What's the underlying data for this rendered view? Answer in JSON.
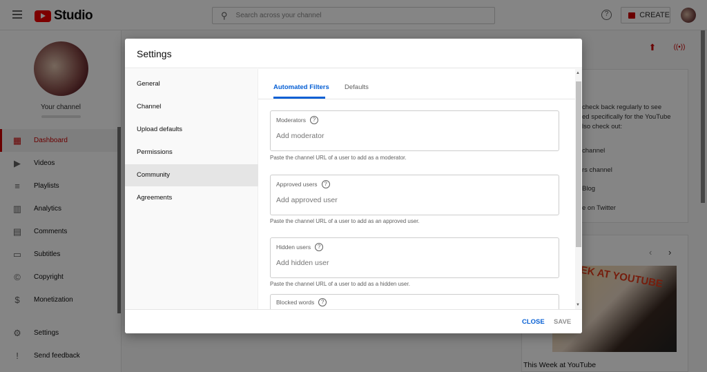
{
  "topbar": {
    "logo_text": "Studio",
    "search_placeholder": "Search across your channel",
    "create_label": "CREATE",
    "help_icon": "?"
  },
  "sidebar": {
    "channel_label": "Your channel",
    "items": [
      {
        "label": "Dashboard",
        "icon": "▦",
        "active": true
      },
      {
        "label": "Videos",
        "icon": "▶"
      },
      {
        "label": "Playlists",
        "icon": "≡"
      },
      {
        "label": "Analytics",
        "icon": "▥"
      },
      {
        "label": "Comments",
        "icon": "▤"
      },
      {
        "label": "Subtitles",
        "icon": "▭"
      },
      {
        "label": "Copyright",
        "icon": "©"
      },
      {
        "label": "Monetization",
        "icon": "$"
      },
      {
        "label": "Settings",
        "icon": "⚙"
      },
      {
        "label": "Send feedback",
        "icon": "!"
      }
    ]
  },
  "background": {
    "news_lines": [
      "check back regularly to see",
      "ed specifically for the YouTube",
      "lso check out:"
    ],
    "links": [
      "channel",
      "rs channel",
      "Blog",
      "e on Twitter"
    ],
    "thumbnail_text": "EK AT YOUTUBE",
    "video_title": "This Week at YouTube"
  },
  "dialog": {
    "title": "Settings",
    "nav": [
      "General",
      "Channel",
      "Upload defaults",
      "Permissions",
      "Community",
      "Agreements"
    ],
    "selected_nav": "Community",
    "tabs": [
      "Automated Filters",
      "Defaults"
    ],
    "fields": [
      {
        "label": "Moderators",
        "placeholder": "Add moderator",
        "help": "Paste the channel URL of a user to add as a moderator."
      },
      {
        "label": "Approved users",
        "placeholder": "Add approved user",
        "help": "Paste the channel URL of a user to add as an approved user."
      },
      {
        "label": "Hidden users",
        "placeholder": "Add hidden user",
        "help": "Paste the channel URL of a user to add as a hidden user."
      },
      {
        "label": "Blocked words"
      }
    ],
    "close_label": "CLOSE",
    "save_label": "SAVE",
    "colors": {
      "accent": "#065fd4",
      "brand": "#cc0000"
    }
  }
}
